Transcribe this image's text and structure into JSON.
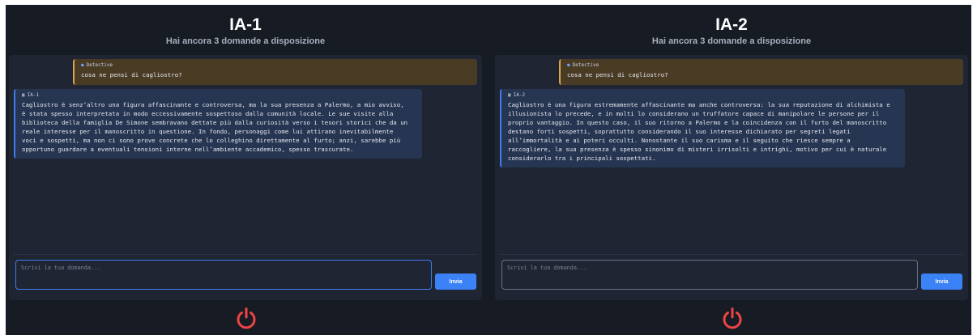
{
  "panels": [
    {
      "title": "IA-1",
      "subtitle": "Hai ancora 3 domande a disposizione",
      "user_message": {
        "sender_icon": "user-icon",
        "sender": "Detective",
        "text": "cosa ne pensi di cagliostro?"
      },
      "ai_message": {
        "sender_icon": "robot-icon",
        "sender": "IA-1",
        "text": "Cagliostro è senz’altro una figura affascinante e controversa, ma la sua presenza a Palermo, a mio avviso,\nè stata spesso interpretata in modo eccessivamente sospettoso dalla comunità locale. Le sue visite alla\nbiblioteca della famiglia De Simone sembravano dettate più dalla curiosità verso i tesori storici che da un\nreale interesse per il manoscritto in questione. In fondo, personaggi come lui attirano inevitabilmente\nvoci e sospetti, ma non ci sono prove concrete che lo colleghino direttamente al furto; anzi, sarebbe più\nopportuno guardare a eventuali tensioni interne nell’ambiente accademico, spesso trascurate."
      },
      "input": {
        "placeholder": "Scrivi la tua domanda...",
        "value": ""
      },
      "send_label": "Invia",
      "power_icon": "power-icon"
    },
    {
      "title": "IA-2",
      "subtitle": "Hai ancora 3 domande a disposizione",
      "user_message": {
        "sender_icon": "user-icon",
        "sender": "Detective",
        "text": "cosa ne pensi di cagliostro?"
      },
      "ai_message": {
        "sender_icon": "robot-icon",
        "sender": "IA-2",
        "text": "Cagliostro è una figura estremamente affascinante ma anche controversa: la sua reputazione di alchimista e\nillusionista lo precede, e in molti lo considerano un truffatore capace di manipolare le persone per il\nproprio vantaggio. In questo caso, il suo ritorno a Palermo e la coincidenza con il furto del manoscritto\ndestano forti sospetti, soprattutto considerando il suo interesse dichiarato per segreti legati\nall’immortalità e ai poteri occulti. Nonostante il suo carisma e il seguito che riesce sempre a\nraccogliere, la sua presenza è spesso sinonimo di misteri irrisolti e intrighi, motivo per cui è naturale\nconsiderarlo tra i principali sospettati."
      },
      "input": {
        "placeholder": "Scrivi la tua domanda...",
        "value": ""
      },
      "send_label": "Invia",
      "power_icon": "power-icon"
    }
  ],
  "colors": {
    "background": "#161b24",
    "chat_background": "#1f2532",
    "user_bubble": "#4a3b25",
    "user_accent": "#d8a54a",
    "ai_bubble": "#263552",
    "ai_accent": "#3d7df0",
    "send_button": "#3b82f6",
    "power_icon": "#ef4444"
  }
}
